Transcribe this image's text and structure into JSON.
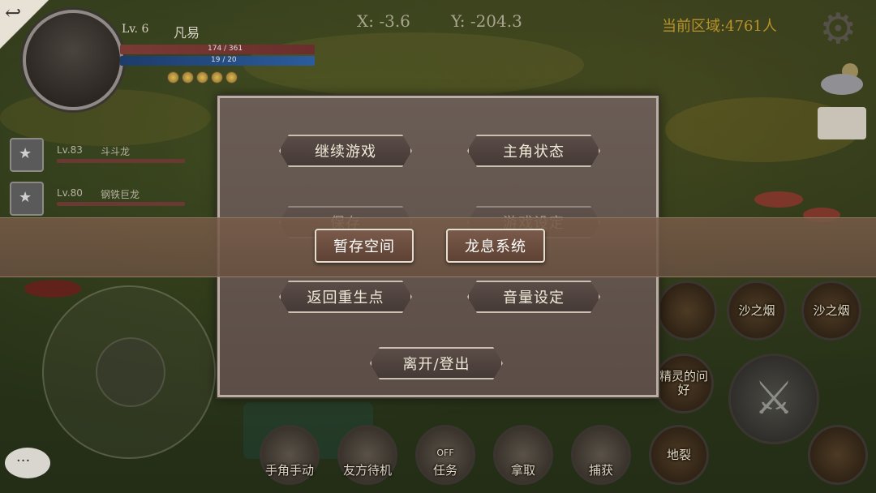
{
  "hud": {
    "back_icon": "back-arrow-icon",
    "player": {
      "level": "Lv. 6",
      "name": "凡易",
      "hp": "174 / 361",
      "mp": "19 / 20"
    },
    "coords": {
      "x": "X: -3.6",
      "y": "Y: -204.3"
    },
    "area_population": "当前区域:4761人",
    "settings_icon": "gear-icon"
  },
  "pets": [
    {
      "level": "Lv.83",
      "name": "斗斗龙"
    },
    {
      "level": "Lv.80",
      "name": "钢铁巨龙"
    }
  ],
  "menu": {
    "continue": "继续游戏",
    "status": "主角状态",
    "save": "保存",
    "game_settings": "游戏设定",
    "storage": "暂存空间",
    "dragon_breath": "龙息系统",
    "respawn": "返回重生点",
    "volume": "音量设定",
    "logout": "离开/登出"
  },
  "skills": {
    "sand_smoke_1": "沙之烟",
    "sand_smoke_2": "沙之烟",
    "spirit_greeting": "精灵的问好",
    "earth_crack": "地裂"
  },
  "bottom_bar": {
    "manual": "手角手动",
    "ally": "友方待机",
    "quest_toggle": "OFF",
    "quest": "任务",
    "pickup": "拿取",
    "capture": "捕获"
  },
  "colors": {
    "menu_bg": "#5f524b",
    "ribbon_bg": "#765a48",
    "area_text": "#b9922a"
  }
}
